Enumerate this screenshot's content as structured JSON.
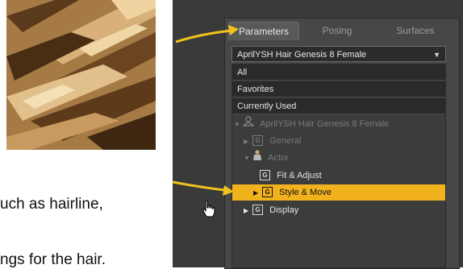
{
  "document": {
    "line1": "uch as hairline,",
    "line2": "ngs for the hair."
  },
  "tabs": [
    {
      "label": "Parameters",
      "active": true
    },
    {
      "label": "Posing",
      "active": false
    },
    {
      "label": "Surfaces",
      "active": false
    }
  ],
  "dropdown": {
    "value": "AprilYSH Hair Genesis 8 Female"
  },
  "filters": [
    "All",
    "Favorites",
    "Currently Used"
  ],
  "tree": {
    "root": "AprilYSH Hair Genesis 8 Female",
    "general": "General",
    "actor": "Actor",
    "fit_adjust": "Fit & Adjust",
    "style_move": "Style & Move",
    "display": "Display",
    "group_glyph": "G"
  },
  "colors": {
    "selected": "#f2b21e",
    "arrow": "#f2c21c"
  }
}
